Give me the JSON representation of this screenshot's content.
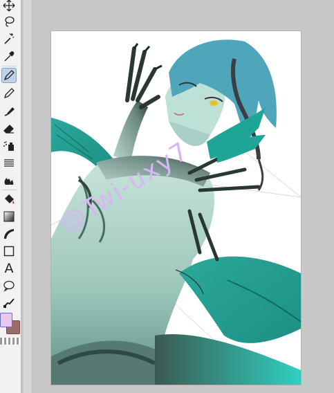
{
  "toolbar": {
    "tools": [
      {
        "name": "move-icon"
      },
      {
        "name": "lasso-icon"
      },
      {
        "name": "magic-wand-icon"
      },
      {
        "name": "eyedropper-icon"
      },
      {
        "name": "pen-icon",
        "active": true
      },
      {
        "name": "pencil-icon"
      },
      {
        "name": "brush-icon"
      },
      {
        "name": "eraser-icon"
      },
      {
        "name": "airbrush-icon"
      },
      {
        "name": "blend-icon"
      },
      {
        "name": "fill-bucket-icon"
      },
      {
        "name": "gradient-icon"
      },
      {
        "name": "figure-icon"
      },
      {
        "name": "rectangle-icon"
      },
      {
        "name": "text-tool-icon",
        "glyph": "A"
      },
      {
        "name": "speech-balloon-icon"
      },
      {
        "name": "correct-line-icon"
      }
    ],
    "colors": {
      "foreground": "#e8c8f0",
      "background": "#9b6b6b"
    }
  },
  "canvas": {
    "watermark": "@Twi-uxy7",
    "colors": {
      "skin": "#a9cfc5",
      "hair": "#4fa5b8",
      "fin": "#1fb3a3",
      "claw": "#3e5048"
    }
  }
}
